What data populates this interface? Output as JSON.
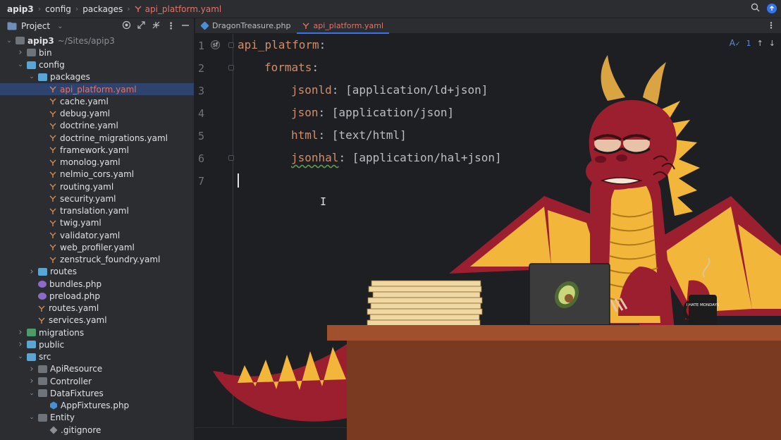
{
  "breadcrumbs": [
    "apip3",
    "config",
    "packages",
    "api_platform.yaml"
  ],
  "project_panel": {
    "title": "Project",
    "tree": [
      {
        "label": "apip3",
        "path": "~/Sites/apip3",
        "depth": 0,
        "expanded": true,
        "kind": "folder"
      },
      {
        "label": "bin",
        "depth": 1,
        "expanded": false,
        "kind": "folder"
      },
      {
        "label": "config",
        "depth": 1,
        "expanded": true,
        "kind": "folder-blue"
      },
      {
        "label": "packages",
        "depth": 2,
        "expanded": true,
        "kind": "folder-blue"
      },
      {
        "label": "api_platform.yaml",
        "depth": 3,
        "kind": "yaml",
        "selected": true
      },
      {
        "label": "cache.yaml",
        "depth": 3,
        "kind": "yaml"
      },
      {
        "label": "debug.yaml",
        "depth": 3,
        "kind": "yaml"
      },
      {
        "label": "doctrine.yaml",
        "depth": 3,
        "kind": "yaml"
      },
      {
        "label": "doctrine_migrations.yaml",
        "depth": 3,
        "kind": "yaml"
      },
      {
        "label": "framework.yaml",
        "depth": 3,
        "kind": "yaml"
      },
      {
        "label": "monolog.yaml",
        "depth": 3,
        "kind": "yaml"
      },
      {
        "label": "nelmio_cors.yaml",
        "depth": 3,
        "kind": "yaml"
      },
      {
        "label": "routing.yaml",
        "depth": 3,
        "kind": "yaml"
      },
      {
        "label": "security.yaml",
        "depth": 3,
        "kind": "yaml"
      },
      {
        "label": "translation.yaml",
        "depth": 3,
        "kind": "yaml"
      },
      {
        "label": "twig.yaml",
        "depth": 3,
        "kind": "yaml"
      },
      {
        "label": "validator.yaml",
        "depth": 3,
        "kind": "yaml"
      },
      {
        "label": "web_profiler.yaml",
        "depth": 3,
        "kind": "yaml"
      },
      {
        "label": "zenstruck_foundry.yaml",
        "depth": 3,
        "kind": "yaml"
      },
      {
        "label": "routes",
        "depth": 2,
        "expanded": false,
        "kind": "folder-blue"
      },
      {
        "label": "bundles.php",
        "depth": 2,
        "kind": "php"
      },
      {
        "label": "preload.php",
        "depth": 2,
        "kind": "php"
      },
      {
        "label": "routes.yaml",
        "depth": 2,
        "kind": "yaml"
      },
      {
        "label": "services.yaml",
        "depth": 2,
        "kind": "yaml"
      },
      {
        "label": "migrations",
        "depth": 1,
        "expanded": false,
        "kind": "folder-green"
      },
      {
        "label": "public",
        "depth": 1,
        "expanded": false,
        "kind": "folder-blue"
      },
      {
        "label": "src",
        "depth": 1,
        "expanded": true,
        "kind": "folder-blue"
      },
      {
        "label": "ApiResource",
        "depth": 2,
        "expanded": false,
        "kind": "folder"
      },
      {
        "label": "Controller",
        "depth": 2,
        "expanded": false,
        "kind": "folder"
      },
      {
        "label": "DataFixtures",
        "depth": 2,
        "expanded": true,
        "kind": "folder"
      },
      {
        "label": "AppFixtures.php",
        "depth": 3,
        "kind": "class"
      },
      {
        "label": "Entity",
        "depth": 2,
        "expanded": true,
        "kind": "folder"
      },
      {
        "label": ".gitignore",
        "depth": 3,
        "kind": "gitignore"
      }
    ]
  },
  "tabs": [
    {
      "label": "DragonTreasure.php",
      "active": false
    },
    {
      "label": "api_platform.yaml",
      "active": true
    }
  ],
  "editor": {
    "inspections": "1",
    "lines": [
      {
        "n": "1",
        "key": "api_platform",
        "value": ""
      },
      {
        "n": "2",
        "key": "formats",
        "value": ""
      },
      {
        "n": "3",
        "key": "jsonld",
        "value": "[application/ld+json]"
      },
      {
        "n": "4",
        "key": "json",
        "value": "[application/json]"
      },
      {
        "n": "5",
        "key": "html",
        "value": "[text/html]"
      },
      {
        "n": "6",
        "key": "jsonhal",
        "value": "[application/hal+json]"
      },
      {
        "n": "7",
        "key": "",
        "value": ""
      }
    ]
  },
  "illustration": {
    "mug_text": "I HATE MONDAYS",
    "colors": {
      "dragon": "#9b1f2e",
      "wing": "#f2b63b",
      "desk": "#7a3a22",
      "laptop": "#3a3a3a"
    }
  }
}
